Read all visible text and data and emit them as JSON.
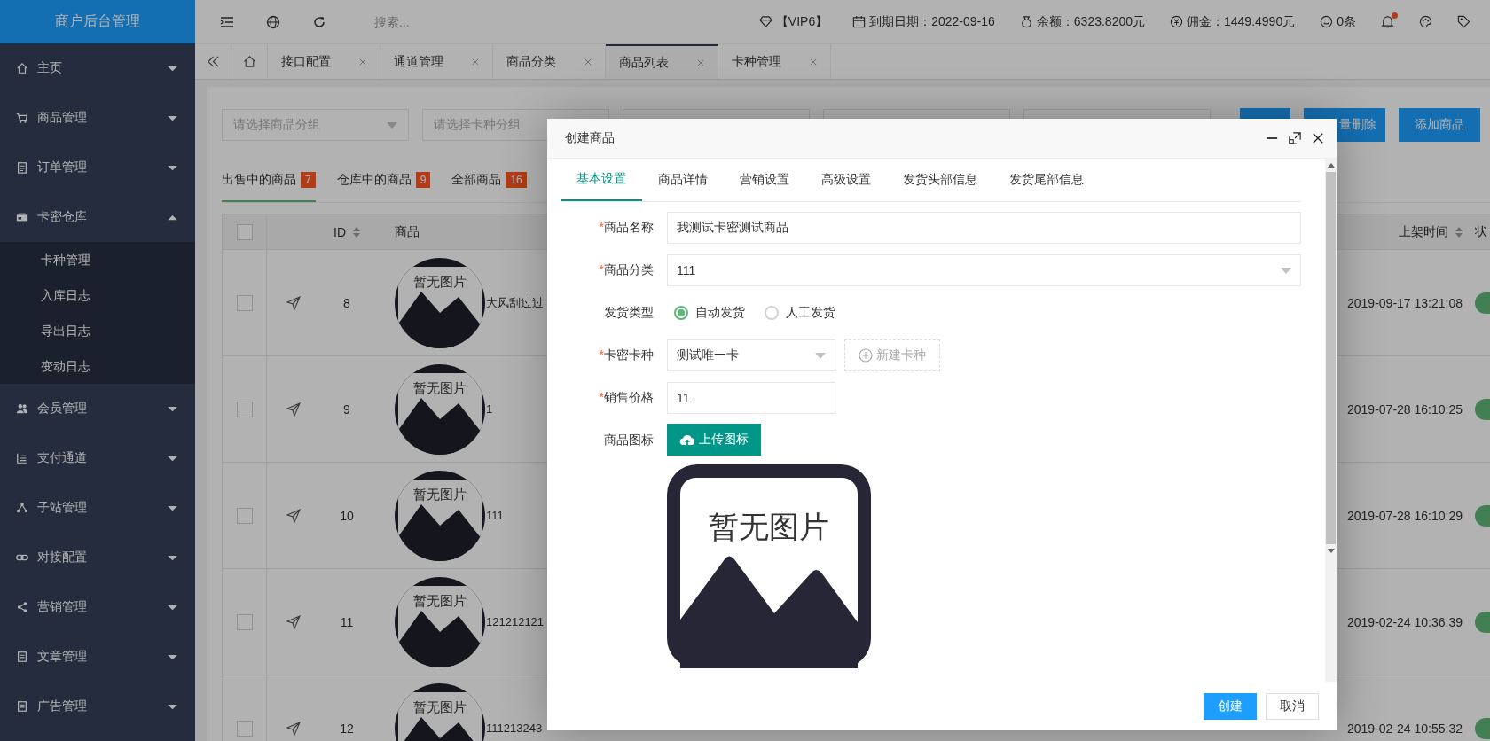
{
  "sidebar": {
    "logo": "商户后台管理",
    "items": [
      {
        "label": "主页",
        "expanded": false
      },
      {
        "label": "商品管理",
        "expanded": false
      },
      {
        "label": "订单管理",
        "expanded": false
      },
      {
        "label": "卡密仓库",
        "expanded": true,
        "children": [
          {
            "label": "卡种管理"
          },
          {
            "label": "入库日志"
          },
          {
            "label": "导出日志"
          },
          {
            "label": "变动日志"
          }
        ]
      },
      {
        "label": "会员管理",
        "expanded": false
      },
      {
        "label": "支付通道",
        "expanded": false
      },
      {
        "label": "子站管理",
        "expanded": false
      },
      {
        "label": "对接配置",
        "expanded": false
      },
      {
        "label": "营销管理",
        "expanded": false
      },
      {
        "label": "文章管理",
        "expanded": false
      },
      {
        "label": "广告管理",
        "expanded": false
      }
    ]
  },
  "toolbar": {
    "search": {
      "placeholder": "搜索..."
    },
    "vip": "【VIP6】",
    "expiry": "到期日期：2022-09-16",
    "balance": "余额：6323.8200元",
    "commission": "佣金：1449.4990元",
    "messages": "0条",
    "notification_dot": true
  },
  "page_tabs": [
    {
      "label": "接口配置",
      "selected": false
    },
    {
      "label": "通道管理",
      "selected": false
    },
    {
      "label": "商品分类",
      "selected": false
    },
    {
      "label": "商品列表",
      "selected": true
    },
    {
      "label": "卡种管理",
      "selected": false
    }
  ],
  "filters": [
    {
      "kind": "select",
      "placeholder": "请选择商品分组"
    },
    {
      "kind": "input",
      "placeholder": "请选择卡种分组"
    },
    {
      "kind": "input"
    },
    {
      "kind": "input"
    },
    {
      "kind": "input"
    }
  ],
  "actions": [
    {
      "kind": "blank"
    },
    {
      "kind": "label",
      "label": "量删除"
    },
    {
      "kind": "label",
      "label": "添加商品"
    }
  ],
  "product_tabs": [
    {
      "label": "出售中的商品",
      "count": "7",
      "selected": true
    },
    {
      "label": "仓库中的商品",
      "count": "9",
      "selected": false
    },
    {
      "label": "全部商品",
      "count": "16",
      "selected": false
    }
  ],
  "table": {
    "header_checked": false,
    "columns": [
      {
        "label": "ID",
        "sortable": true
      },
      {
        "label": "商品",
        "sortable": false
      },
      {
        "label": "上架时间",
        "sortable": true
      },
      {
        "label": "状"
      }
    ],
    "rows": [
      {
        "checked": false,
        "id": "8",
        "image_text": "暂无图片",
        "name": "大风刮过过",
        "time": "2019-09-17 13:21:08"
      },
      {
        "checked": false,
        "id": "9",
        "image_text": "暂无图片",
        "name": "1",
        "time": "2019-07-28 16:10:25"
      },
      {
        "checked": false,
        "id": "10",
        "image_text": "暂无图片",
        "name": "111",
        "time": "2019-07-28 16:10:29"
      },
      {
        "checked": false,
        "id": "11",
        "image_text": "暂无图片",
        "name": "121212121",
        "time": "2019-02-24 10:36:39"
      },
      {
        "checked": false,
        "id": "12",
        "image_text": "暂无图片",
        "name": "111213243",
        "time": "2019-02-24 10:55:32"
      }
    ]
  },
  "modal": {
    "title": "创建商品",
    "tabs": [
      {
        "label": "基本设置",
        "selected": true
      },
      {
        "label": "商品详情",
        "selected": false
      },
      {
        "label": "营销设置",
        "selected": false
      },
      {
        "label": "高级设置",
        "selected": false
      },
      {
        "label": "发货头部信息",
        "selected": false
      },
      {
        "label": "发货尾部信息",
        "selected": false
      }
    ],
    "fields": [
      {
        "kind": "text",
        "label": "商品名称",
        "required_mark": "*",
        "value": "我测试卡密测试商品"
      },
      {
        "kind": "select",
        "label": "商品分类",
        "required_mark": "*",
        "value": "111"
      },
      {
        "kind": "radio",
        "label": "发货类型",
        "options": [
          {
            "label": "自动发货",
            "selected": true
          },
          {
            "label": "人工发货",
            "selected": false
          }
        ]
      },
      {
        "kind": "select_with_button",
        "label": "卡密卡种",
        "required_mark": "*",
        "value": "测试唯一卡",
        "button": {
          "label": "新建卡种",
          "disabled": true
        }
      },
      {
        "kind": "short_text",
        "label": "销售价格",
        "required_mark": "*",
        "value": "11"
      },
      {
        "kind": "upload",
        "label": "商品图标",
        "button": "上传图标",
        "image_text": "暂无图片"
      }
    ],
    "buttons": [
      {
        "kind": "primary",
        "label": "创建"
      },
      {
        "kind": "default",
        "label": "取消"
      }
    ]
  }
}
